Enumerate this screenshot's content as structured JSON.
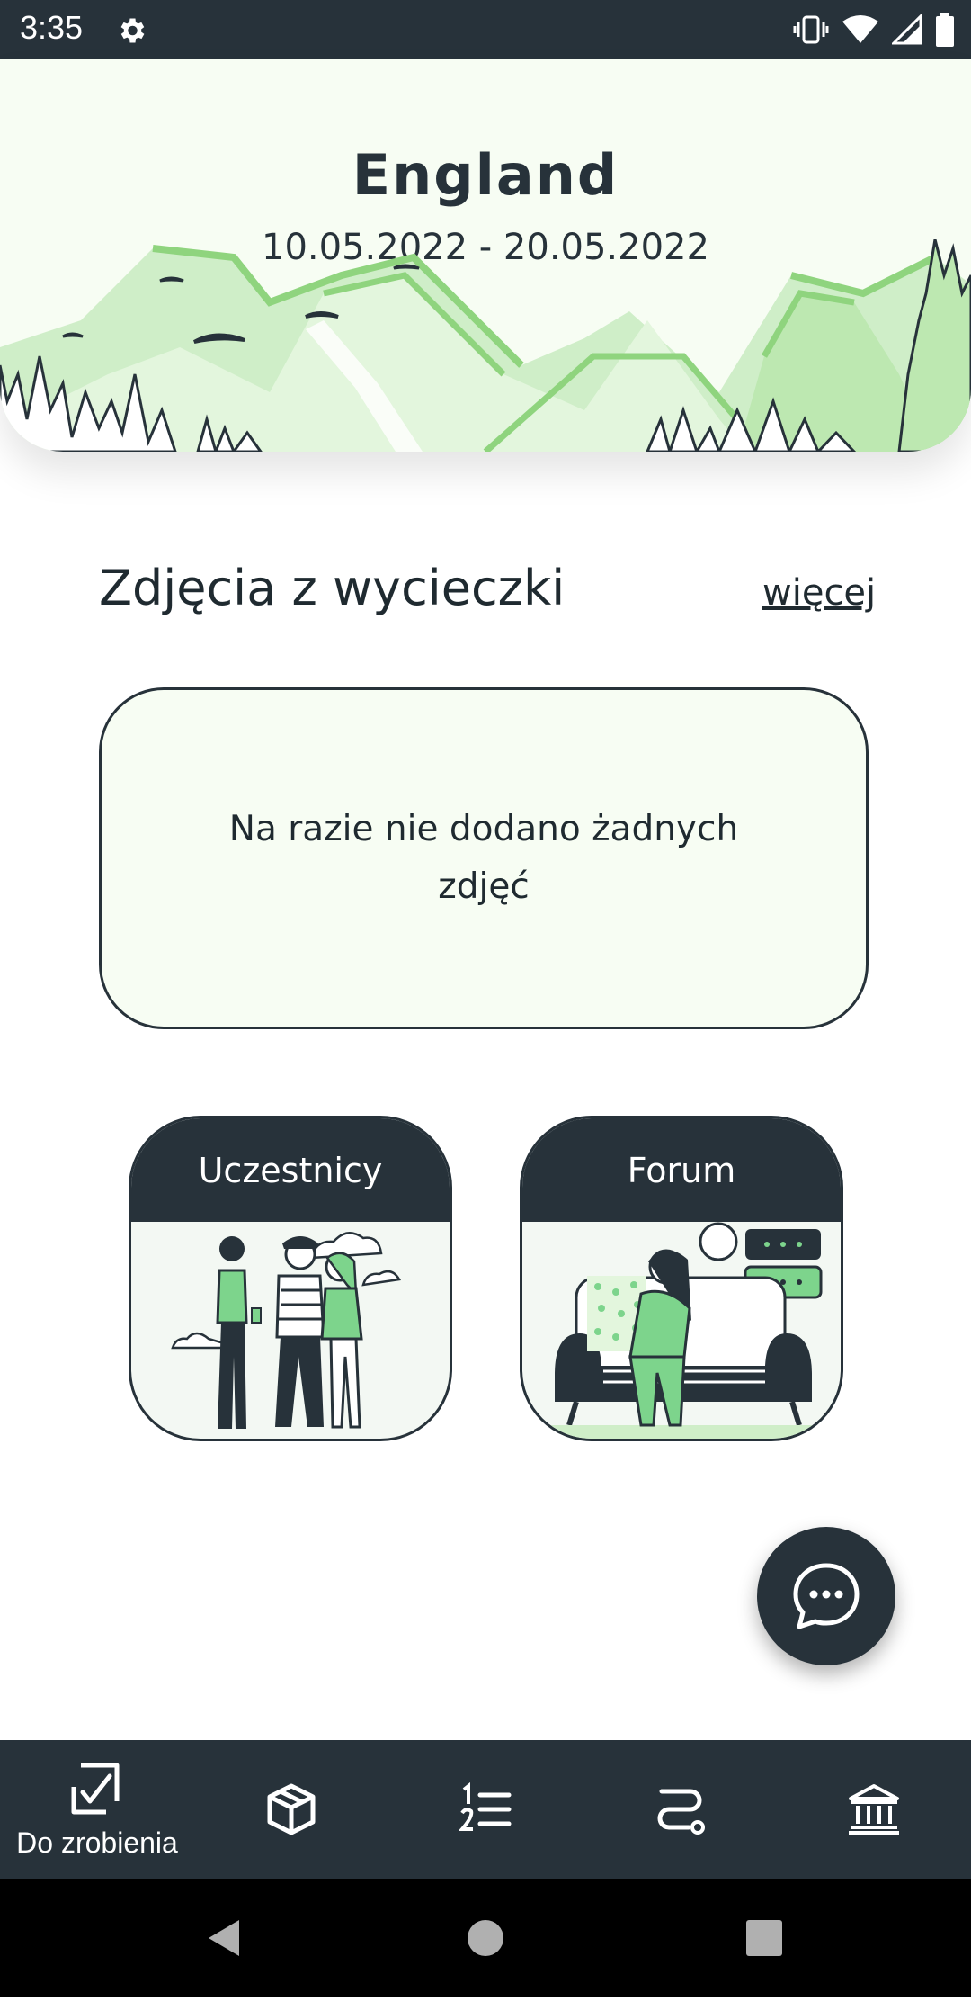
{
  "status_bar": {
    "time": "3:35"
  },
  "header": {
    "title": "England",
    "dates": "10.05.2022 - 20.05.2022"
  },
  "photos": {
    "section_title": "Zdjęcia z wycieczki",
    "more_link": "więcej",
    "empty_message": "Na razie nie dodano żadnych zdjęć"
  },
  "cards": [
    {
      "label": "Uczestnicy",
      "icon": "people-illustration"
    },
    {
      "label": "Forum",
      "icon": "forum-illustration"
    }
  ],
  "fab": {
    "icon": "chat-bubble-icon"
  },
  "bottom_nav": {
    "items": [
      {
        "label": "Do zrobienia",
        "icon": "checkbox-icon",
        "active": true
      },
      {
        "icon": "package-icon"
      },
      {
        "icon": "numbered-list-icon"
      },
      {
        "icon": "route-icon"
      },
      {
        "icon": "bank-icon"
      }
    ]
  },
  "colors": {
    "dark": "#27323a",
    "accent_green": "#7dd48c",
    "light_green": "#f7fdf3"
  }
}
